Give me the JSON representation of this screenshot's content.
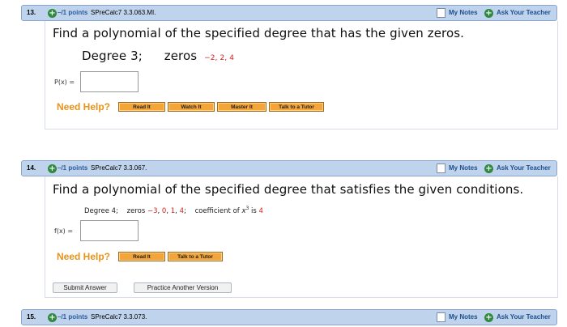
{
  "q13": {
    "number": "13.",
    "points": "–/1 points",
    "source": "SPreCalc7 3.3.063.MI.",
    "my_notes": "My Notes",
    "ask_teacher": "Ask Your Teacher",
    "prompt": "Find a polynomial of the specified degree that has the given zeros.",
    "degree_label": "Degree 3;",
    "zeros_label": "zeros",
    "zeros_values": "−2, 2, 4",
    "answer_label": "P(x) =",
    "answer_value": "",
    "need_help": "Need Help?",
    "help_buttons": [
      "Read It",
      "Watch It",
      "Master It",
      "Talk to a Tutor"
    ]
  },
  "q14": {
    "number": "14.",
    "points": "–/1 points",
    "source": "SPreCalc7 3.3.067.",
    "my_notes": "My Notes",
    "ask_teacher": "Ask Your Teacher",
    "prompt": "Find a polynomial of the specified degree that satisfies the given conditions.",
    "degree_label": "Degree 4;",
    "zeros_label": "zeros",
    "zeros_values": [
      "−3",
      "0",
      "1",
      "4"
    ],
    "coef_label": "coefficient of",
    "coef_var": "x",
    "coef_exp": "3",
    "coef_is": "is",
    "coef_value": "4",
    "answer_label": "f(x) =",
    "answer_value": "",
    "need_help": "Need Help?",
    "help_buttons": [
      "Read It",
      "Talk to a Tutor"
    ],
    "submit": "Submit Answer",
    "practice": "Practice Another Version"
  },
  "q15": {
    "number": "15.",
    "points": "–/1 points",
    "source": "SPreCalc7 3.3.073.",
    "my_notes": "My Notes",
    "ask_teacher": "Ask Your Teacher"
  },
  "colors": {
    "header_bg": "#bfd3ec",
    "accent_red": "#d02020",
    "need_help": "#e8931a",
    "help_button": "#f4a53a",
    "plus_green": "#2f8a3e"
  }
}
